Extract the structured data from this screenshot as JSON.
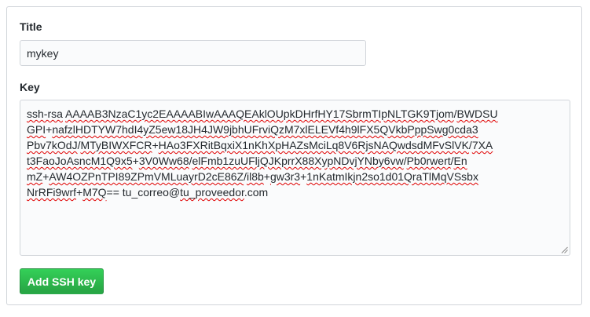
{
  "form": {
    "title_label": "Title",
    "title_value": "mykey",
    "key_label": "Key",
    "key_lines": [
      [
        {
          "t": "ssh-rsa",
          "s": true
        },
        {
          "t": " ",
          "s": false
        },
        {
          "t": "AAAAB3NzaC1yc2EAAAABIwAAAQEAklOUpkDHrfHY17SbrmTIpNLTGK9Tjom",
          "s": true
        },
        {
          "t": "/",
          "s": false
        },
        {
          "t": "BWDSU",
          "s": true
        }
      ],
      [
        {
          "t": "GPI",
          "s": true
        },
        {
          "t": "+",
          "s": false
        },
        {
          "t": "nafzlHDTYW7hdI4yZ5ew18JH4JW9jbhUFrviQzM7xlELEVf4h9lFX5QVkbPppSwg0cda3",
          "s": true
        }
      ],
      [
        {
          "t": "Pbv7kOdJ",
          "s": true
        },
        {
          "t": "/",
          "s": false
        },
        {
          "t": "MTyBIWXFCR",
          "s": true
        },
        {
          "t": "+",
          "s": false
        },
        {
          "t": "HAo3FXRitBqxiX1nKhXpHAZsMciLq8V6RjsNAQwdsdMFvSlVK",
          "s": true
        },
        {
          "t": "/",
          "s": false
        },
        {
          "t": "7XA",
          "s": true
        }
      ],
      [
        {
          "t": "t3FaoJoAsncM1Q9x5",
          "s": true
        },
        {
          "t": "+",
          "s": false
        },
        {
          "t": "3V0Ww68",
          "s": true
        },
        {
          "t": "/",
          "s": false
        },
        {
          "t": "elFmb1zuUFljQJKprrX88XypNDvjYNby6vw",
          "s": true
        },
        {
          "t": "/",
          "s": false
        },
        {
          "t": "Pb0rwert",
          "s": true
        },
        {
          "t": "/",
          "s": false
        },
        {
          "t": "En",
          "s": true
        }
      ],
      [
        {
          "t": "mZ",
          "s": true
        },
        {
          "t": "+",
          "s": false
        },
        {
          "t": "AW4OZPnTPI89ZPmVMLuayrD2cE86Z",
          "s": true
        },
        {
          "t": "/",
          "s": false
        },
        {
          "t": "il8b",
          "s": true
        },
        {
          "t": "+",
          "s": false
        },
        {
          "t": "gw3r3",
          "s": true
        },
        {
          "t": "+",
          "s": false
        },
        {
          "t": "1nKatmIkjn2so1d01QraTlMqVSsbx",
          "s": true
        }
      ],
      [
        {
          "t": "NrRFi9wrf",
          "s": true
        },
        {
          "t": "+",
          "s": false
        },
        {
          "t": "M7Q",
          "s": true
        },
        {
          "t": "== tu_correo@",
          "s": false
        },
        {
          "t": "tu_proveedor",
          "s": true
        },
        {
          "t": ".com",
          "s": false
        }
      ]
    ],
    "submit_label": "Add SSH key"
  },
  "colors": {
    "button_green": "#28a745",
    "spellcheck_underline": "#e00000",
    "border": "#d1d5da",
    "text": "#24292e"
  }
}
